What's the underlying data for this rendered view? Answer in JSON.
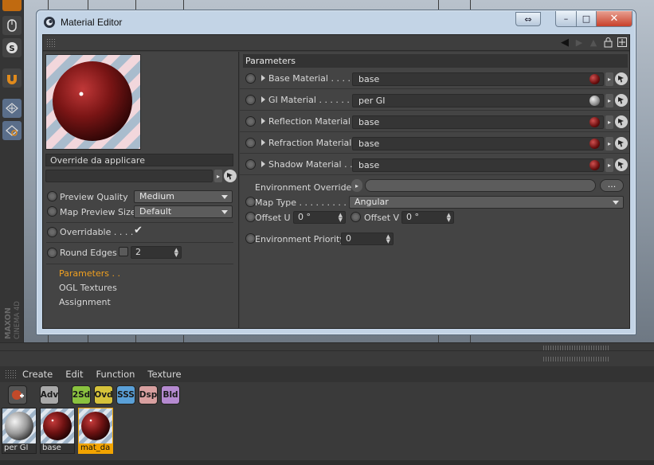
{
  "window": {
    "title": "Material Editor",
    "restore_icon": "⇔",
    "minimize_icon": "–",
    "maximize_icon": "□",
    "close_icon": "✕"
  },
  "toolbar": {
    "back_icon": "◀",
    "lock_icon": "🔒",
    "new_panel_icon": "⊞"
  },
  "left": {
    "material_name": "Override da applicare",
    "preview_quality_label": "Preview Quality",
    "preview_quality_value": "Medium",
    "map_preview_size_label": "Map Preview Size",
    "map_preview_size_value": "Default",
    "overridable_label": "Overridable . . . .",
    "overridable_check": "✔",
    "round_edges_label": "Round Edges",
    "round_edges_value": "2",
    "nav": [
      "Parameters . .",
      "OGL Textures",
      "Assignment"
    ]
  },
  "right": {
    "section_title": "Parameters",
    "rows": [
      {
        "label": "Base Material . . . . .",
        "value": "base",
        "ball_color": "#8a1a1a"
      },
      {
        "label": "GI Material . . . . . . .",
        "value": "per GI",
        "ball_color": "#b0b0b0"
      },
      {
        "label": "Reflection Material",
        "value": "base",
        "ball_color": "#8a1a1a"
      },
      {
        "label": "Refraction Material",
        "value": "base",
        "ball_color": "#8a1a1a"
      },
      {
        "label": "Shadow Material . .",
        "value": "base",
        "ball_color": "#8a1a1a"
      }
    ],
    "env_override_label": "Environment Override",
    "env_override_dots": "...",
    "map_type_label": "Map Type . . . . . . . . . .",
    "map_type_value": "Angular",
    "offset_u_label": "Offset U",
    "offset_u_value": "0 °",
    "offset_v_label": "Offset V",
    "offset_v_value": "0 °",
    "env_priority_label": "Environment Priority",
    "env_priority_value": "0"
  },
  "material_manager": {
    "menu": [
      "Create",
      "Edit",
      "Function",
      "Texture"
    ],
    "toolbar_buttons": [
      {
        "label": "Adv",
        "color": "#a9a9a9"
      },
      {
        "label": "2Sd",
        "color": "#8ac23f"
      },
      {
        "label": "Ovd",
        "color": "#d6c23a"
      },
      {
        "label": "SSS",
        "color": "#5aa0d8"
      },
      {
        "label": "Dsp",
        "color": "#d8a0a0"
      },
      {
        "label": "Bld",
        "color": "#b58ad0"
      }
    ],
    "materials": [
      {
        "name": "per GI",
        "kind": "grey"
      },
      {
        "name": "base",
        "kind": "red"
      },
      {
        "name": "mat_da",
        "kind": "red",
        "selected": true
      }
    ]
  },
  "app": {
    "brand_text": "MAXON",
    "brand_sub": "CINEMA 4D"
  }
}
